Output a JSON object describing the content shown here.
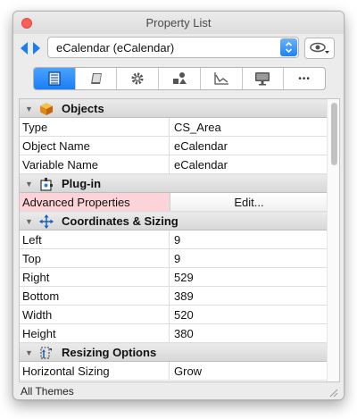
{
  "window": {
    "title": "Property List"
  },
  "object_selector": {
    "selected": "eCalendar (eCalendar)"
  },
  "tabs": [
    {
      "icon": "property-list-icon",
      "active": true
    },
    {
      "icon": "book-icon",
      "active": false
    },
    {
      "icon": "gear-icon",
      "active": false
    },
    {
      "icon": "shapes-icon",
      "active": false
    },
    {
      "icon": "chart-icon",
      "active": false
    },
    {
      "icon": "monitor-icon",
      "active": false
    },
    {
      "icon": "more-icon",
      "active": false,
      "glyph": "•••"
    }
  ],
  "sections": {
    "objects": {
      "title": "Objects",
      "rows": [
        {
          "label": "Type",
          "value": "CS_Area"
        },
        {
          "label": "Object Name",
          "value": "eCalendar"
        },
        {
          "label": "Variable Name",
          "value": "eCalendar"
        }
      ]
    },
    "plugin": {
      "title": "Plug-in",
      "rows": [
        {
          "label": "Advanced Properties",
          "button": "Edit..."
        }
      ]
    },
    "coords": {
      "title": "Coordinates & Sizing",
      "rows": [
        {
          "label": "Left",
          "value": "9"
        },
        {
          "label": "Top",
          "value": "9"
        },
        {
          "label": "Right",
          "value": "529"
        },
        {
          "label": "Bottom",
          "value": "389"
        },
        {
          "label": "Width",
          "value": "520"
        },
        {
          "label": "Height",
          "value": "380"
        }
      ]
    },
    "resizing": {
      "title": "Resizing Options",
      "rows": [
        {
          "label": "Horizontal Sizing",
          "value": "Grow"
        }
      ]
    }
  },
  "status": {
    "text": "All Themes"
  },
  "colors": {
    "accent": "#1b7ef6",
    "close": "#fc5f57",
    "highlight": "#fbd3d9"
  }
}
